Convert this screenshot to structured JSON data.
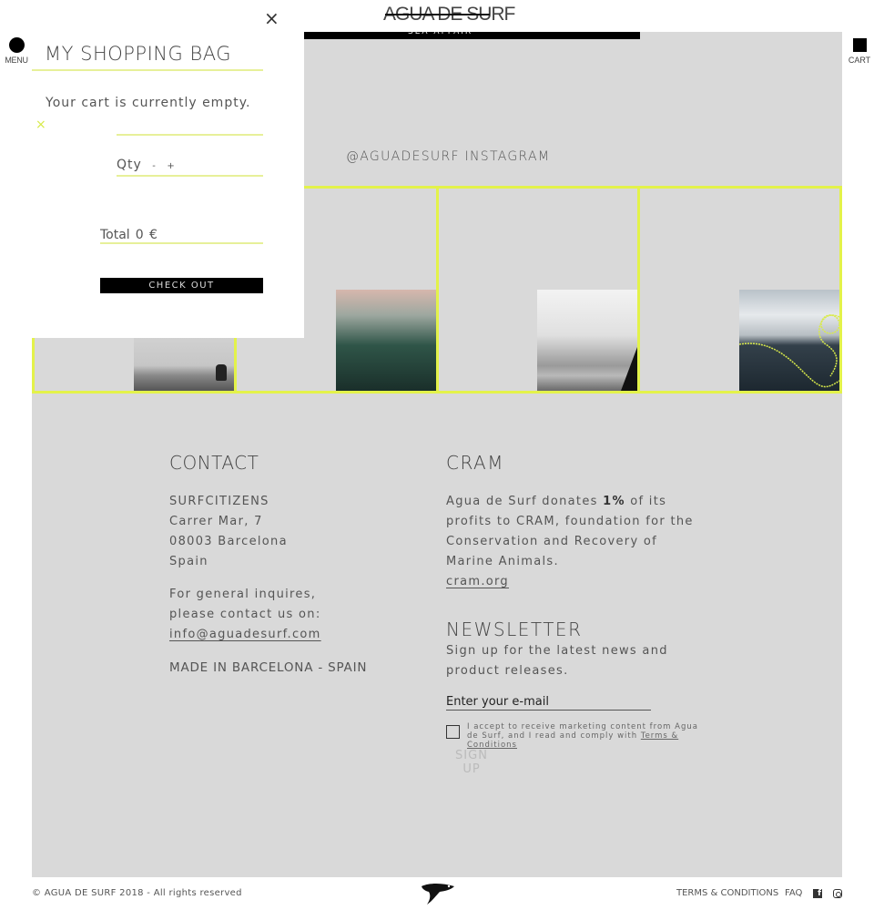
{
  "header": {
    "logo": "AGUA DE SURF",
    "promo": "SEA AFFAIR",
    "menu_label": "MENU",
    "cart_label": "CART"
  },
  "cart": {
    "title": "MY SHOPPING BAG",
    "empty_message": "Your cart is currently empty.",
    "qty_label": "Qty",
    "qty_minus": "-",
    "qty_plus": "+",
    "total_label": "Total",
    "total_value": "0 €",
    "checkout_label": "CHECK OUT",
    "close_icon": "×",
    "remove_icon": "×"
  },
  "instagram": {
    "title": "@AGUADESURF INSTAGRAM",
    "images": [
      "beach-rock-photo",
      "sunset-water-photo",
      "sea-cliff-photo",
      "wave-rope-photo"
    ]
  },
  "contact": {
    "heading": "CONTACT",
    "company": "SURFCITIZENS",
    "street": "Carrer Mar, 7",
    "city": "08003 Barcelona",
    "country": "Spain",
    "inquiry_line1": "For general inquires,",
    "inquiry_line2": "please contact us on:",
    "email": "info@aguadesurf.com",
    "made_in": "MADE IN BARCELONA - SPAIN"
  },
  "cram": {
    "heading": "CRAM",
    "text_before": "Agua de Surf donates ",
    "percent": "1%",
    "text_after": " of its profits to CRAM, foundation for the Conservation and Recovery of Marine Animals.",
    "link": "cram.org"
  },
  "newsletter": {
    "heading": "NEWSLETTER",
    "description": "Sign up for the latest news and product releases.",
    "email_placeholder": "Enter your e-mail",
    "consent_text": "I accept to receive marketing content from Agua de Surf, and I read and comply with ",
    "terms_link": "Terms & Conditions",
    "signup_label": "SIGN UP"
  },
  "footer": {
    "copyright": "© AGUA DE SURF 2018 - All rights reserved",
    "terms": "TERMS & CONDITIONS",
    "faq": "FAQ"
  },
  "colors": {
    "accent": "#e3f24a",
    "background": "#d9d9d9",
    "panel": "#ffffff"
  }
}
